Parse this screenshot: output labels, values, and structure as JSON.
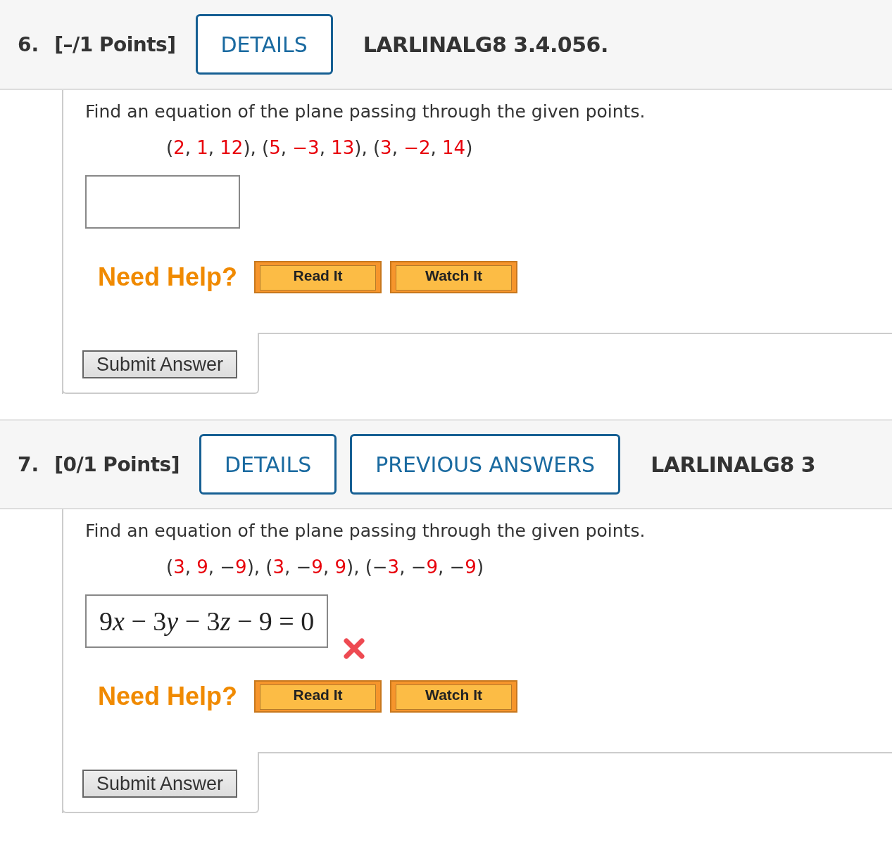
{
  "questions": [
    {
      "number": "6.",
      "points": "[–/1 Points]",
      "header_buttons": [
        "DETAILS"
      ],
      "code": "LARLINALG8 3.4.056.",
      "prompt": "Find an equation of the plane passing through the given points.",
      "given_points": [
        {
          "text": "(",
          "kind": "text"
        },
        {
          "text": "2",
          "kind": "number"
        },
        {
          "text": ", ",
          "kind": "text"
        },
        {
          "text": "1",
          "kind": "number"
        },
        {
          "text": ", ",
          "kind": "text"
        },
        {
          "text": "12",
          "kind": "number"
        },
        {
          "text": "), (",
          "kind": "text"
        },
        {
          "text": "5",
          "kind": "number"
        },
        {
          "text": ", ",
          "kind": "text"
        },
        {
          "text": "−3",
          "kind": "number"
        },
        {
          "text": ", ",
          "kind": "text"
        },
        {
          "text": "13",
          "kind": "number"
        },
        {
          "text": "), (",
          "kind": "text"
        },
        {
          "text": "3",
          "kind": "number"
        },
        {
          "text": ", ",
          "kind": "text"
        },
        {
          "text": "−2",
          "kind": "number"
        },
        {
          "text": ", ",
          "kind": "text"
        },
        {
          "text": "14",
          "kind": "number"
        },
        {
          "text": ")",
          "kind": "text"
        }
      ],
      "help_label": "Need Help?",
      "help_buttons": [
        "Read It",
        "Watch It"
      ],
      "submit": "Submit Answer"
    },
    {
      "number": "7.",
      "points": "[0/1 Points]",
      "header_buttons": [
        "DETAILS",
        "PREVIOUS ANSWERS"
      ],
      "code": "LARLINALG8 3",
      "prompt": "Find an equation of the plane passing through the given points.",
      "given_points": [
        {
          "text": "(",
          "kind": "text"
        },
        {
          "text": "3",
          "kind": "number"
        },
        {
          "text": ", ",
          "kind": "text"
        },
        {
          "text": "9",
          "kind": "number"
        },
        {
          "text": ", −",
          "kind": "text"
        },
        {
          "text": "9",
          "kind": "number"
        },
        {
          "text": "), (",
          "kind": "text"
        },
        {
          "text": "3",
          "kind": "number"
        },
        {
          "text": ", −",
          "kind": "text"
        },
        {
          "text": "9",
          "kind": "number"
        },
        {
          "text": ", ",
          "kind": "text"
        },
        {
          "text": "9",
          "kind": "number"
        },
        {
          "text": "), (−",
          "kind": "text"
        },
        {
          "text": "3",
          "kind": "number"
        },
        {
          "text": ", −",
          "kind": "text"
        },
        {
          "text": "9",
          "kind": "number"
        },
        {
          "text": ", −",
          "kind": "text"
        },
        {
          "text": "9",
          "kind": "number"
        },
        {
          "text": ")",
          "kind": "text"
        }
      ],
      "answer": {
        "value": [
          {
            "text": "9",
            "kind": "text"
          },
          {
            "text": "x",
            "kind": "variable"
          },
          {
            "text": " − 3",
            "kind": "text"
          },
          {
            "text": "y",
            "kind": "variable"
          },
          {
            "text": " − 3",
            "kind": "text"
          },
          {
            "text": "z",
            "kind": "variable"
          },
          {
            "text": " − 9 = 0",
            "kind": "text"
          }
        ],
        "incorrect": true
      },
      "help_label": "Need Help?",
      "help_buttons": [
        "Read It",
        "Watch It"
      ],
      "submit": "Submit Answer"
    }
  ]
}
